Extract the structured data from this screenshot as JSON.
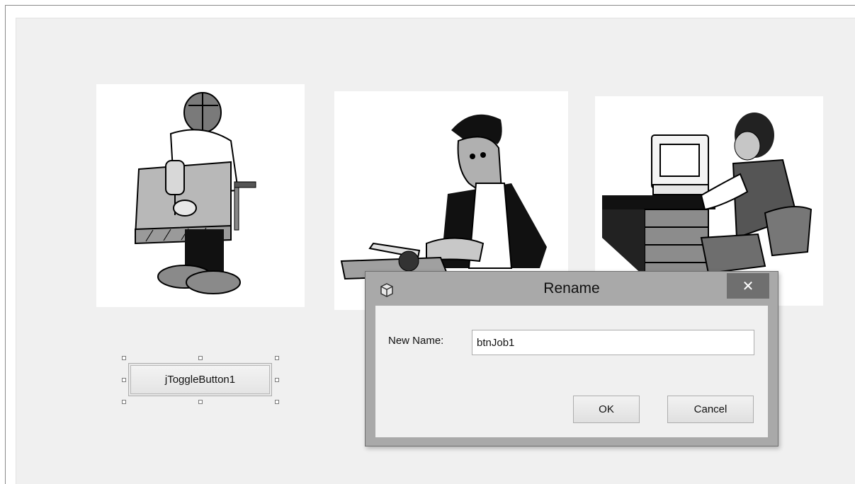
{
  "designer": {
    "toggle_button_label": "jToggleButton1",
    "images": [
      {
        "icon": "carpenter-drilling-image"
      },
      {
        "icon": "butcher-cutting-image"
      },
      {
        "icon": "office-worker-computer-image"
      }
    ]
  },
  "rename_dialog": {
    "title": "Rename",
    "icon": "netbeans-cube-icon",
    "close_glyph": "✕",
    "field_label": "New Name:",
    "new_name_value": "btnJob1",
    "ok_label": "OK",
    "cancel_label": "Cancel"
  },
  "colors": {
    "canvas": "#f0f0f0",
    "dialog_frame": "#a9a9a9",
    "close_button": "#6f6f6f"
  }
}
